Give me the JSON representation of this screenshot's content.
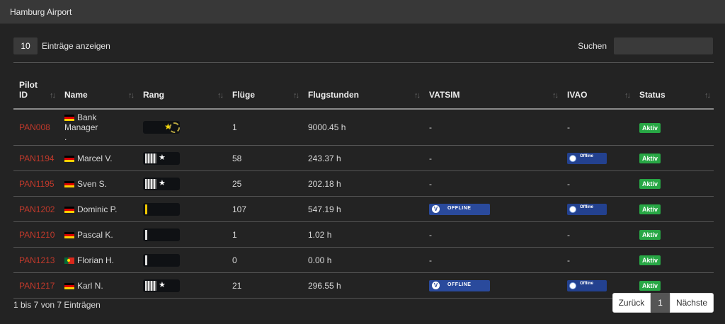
{
  "panel": {
    "title": "Hamburg Airport"
  },
  "controls": {
    "length_value": "10",
    "length_label": "Einträge anzeigen",
    "search_label": "Suchen",
    "search_value": ""
  },
  "table": {
    "headers": [
      "Pilot ID",
      "Name",
      "Rang",
      "Flüge",
      "Flugstunden",
      "VATSIM",
      "IVAO",
      "Status"
    ],
    "header_pilot_line1": "Pilot",
    "header_pilot_line2": "ID",
    "sort_icon": "↑↓",
    "rows": [
      {
        "pilot_id": "PAN008",
        "name": "Bank Manager",
        "name_extra": ".",
        "flag": "de",
        "rank": "star-ring",
        "flights": "1",
        "hours": "9000.45 h",
        "vatsim": "-",
        "ivao": "-",
        "status": "Aktiv"
      },
      {
        "pilot_id": "PAN1194",
        "name": "Marcel V.",
        "name_extra": "",
        "flag": "de",
        "rank": "stripes-star",
        "flights": "58",
        "hours": "243.37 h",
        "vatsim": "-",
        "ivao": "Offline",
        "status": "Aktiv"
      },
      {
        "pilot_id": "PAN1195",
        "name": "Sven S.",
        "name_extra": "",
        "flag": "de",
        "rank": "stripes-star",
        "flights": "25",
        "hours": "202.18 h",
        "vatsim": "-",
        "ivao": "-",
        "status": "Aktiv"
      },
      {
        "pilot_id": "PAN1202",
        "name": "Dominic P.",
        "name_extra": "",
        "flag": "de",
        "rank": "yellow-bar",
        "flights": "107",
        "hours": "547.19 h",
        "vatsim": "OFFLINE",
        "ivao": "Offline",
        "status": "Aktiv"
      },
      {
        "pilot_id": "PAN1210",
        "name": "Pascal K.",
        "name_extra": "",
        "flag": "de",
        "rank": "white-bar",
        "flights": "1",
        "hours": "1.02 h",
        "vatsim": "-",
        "ivao": "-",
        "status": "Aktiv"
      },
      {
        "pilot_id": "PAN1213",
        "name": "Florian H.",
        "name_extra": "",
        "flag": "pt",
        "rank": "white-bar",
        "flights": "0",
        "hours": "0.00 h",
        "vatsim": "-",
        "ivao": "-",
        "status": "Aktiv"
      },
      {
        "pilot_id": "PAN1217",
        "name": "Karl N.",
        "name_extra": "",
        "flag": "de",
        "rank": "stripes-star",
        "flights": "21",
        "hours": "296.55 h",
        "vatsim": "OFFLINE",
        "ivao": "Offline",
        "status": "Aktiv"
      }
    ]
  },
  "footer": {
    "info": "1 bis 7 von 7 Einträgen",
    "prev": "Zurück",
    "page": "1",
    "next": "Nächste"
  },
  "colors": {
    "background": "#232323",
    "header": "#383838",
    "pilot_id": "#c0392b",
    "status_badge": "#28a745",
    "vatsim_badge": "#2a4a9c",
    "ivao_badge": "#23418f"
  },
  "icons": {
    "sort": "sort-arrows-icon",
    "vatsim_logo": "vatsim-logo-icon",
    "ivao_logo": "ivao-logo-icon"
  }
}
